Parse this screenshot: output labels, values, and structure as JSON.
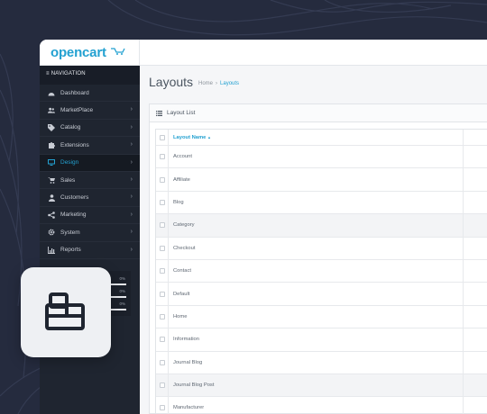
{
  "logo": {
    "text": "opencart"
  },
  "sidebar": {
    "heading": "NAVIGATION",
    "items": [
      {
        "label": "Dashboard",
        "icon": "dashboard-icon",
        "has_submenu": false,
        "active": false
      },
      {
        "label": "MarketPlace",
        "icon": "users-icon",
        "has_submenu": true,
        "active": false
      },
      {
        "label": "Catalog",
        "icon": "tag-icon",
        "has_submenu": true,
        "active": false
      },
      {
        "label": "Extensions",
        "icon": "puzzle-icon",
        "has_submenu": true,
        "active": false
      },
      {
        "label": "Design",
        "icon": "monitor-icon",
        "has_submenu": true,
        "active": true
      },
      {
        "label": "Sales",
        "icon": "cart-icon",
        "has_submenu": true,
        "active": false
      },
      {
        "label": "Customers",
        "icon": "user-icon",
        "has_submenu": true,
        "active": false
      },
      {
        "label": "Marketing",
        "icon": "share-icon",
        "has_submenu": true,
        "active": false
      },
      {
        "label": "System",
        "icon": "gear-icon",
        "has_submenu": true,
        "active": false
      },
      {
        "label": "Reports",
        "icon": "bar-chart-icon",
        "has_submenu": true,
        "active": false
      }
    ],
    "progress": [
      {
        "label": "0%",
        "value": 0
      },
      {
        "label": "0%",
        "value": 0
      },
      {
        "label": "0%",
        "value": 0
      }
    ]
  },
  "main": {
    "title": "Layouts",
    "breadcrumb": [
      {
        "label": "Home"
      },
      {
        "label": "Layouts"
      }
    ],
    "breadcrumb_separator": "›",
    "panel_title": "Layout List",
    "table": {
      "column": "Layout Name",
      "sort_indicator": "▲",
      "rows": [
        "Account",
        "Affiliate",
        "Blog",
        "Category",
        "Checkout",
        "Contact",
        "Default",
        "Home",
        "Information",
        "Journal Blog",
        "Journal Blog Post",
        "Manufacturer"
      ]
    }
  },
  "overlay": {
    "icon": "toolbox-icon"
  },
  "colors": {
    "accent": "#23a1d1",
    "sidebar_bg": "#1f2530",
    "page_bg": "#252b3e"
  }
}
